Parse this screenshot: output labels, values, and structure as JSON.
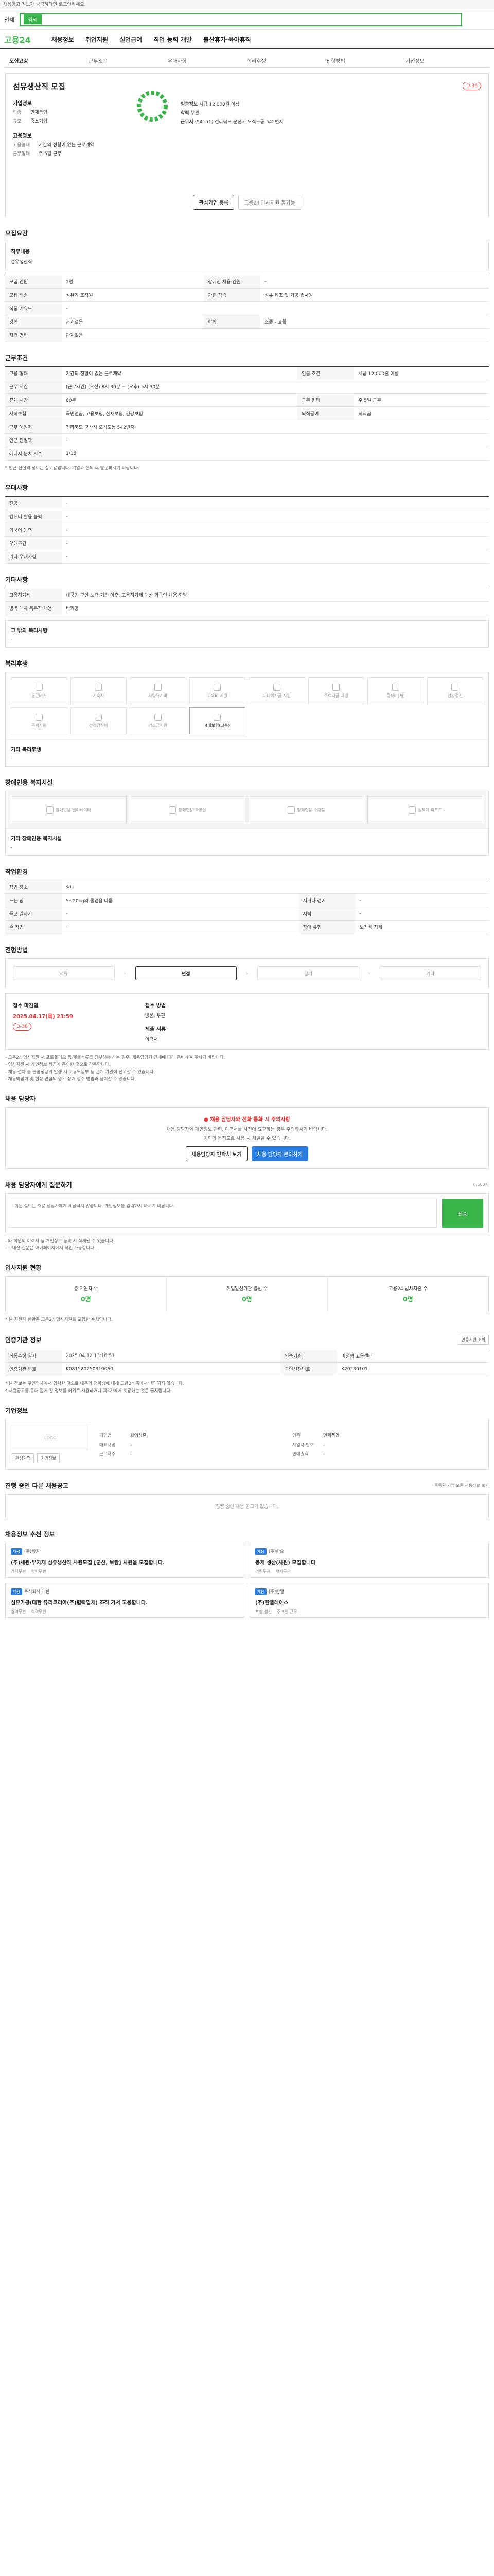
{
  "top_notice": "채용공고 정보가 궁금하다면 로그인하세요.",
  "search": {
    "select": "전체",
    "placeholder": "검색",
    "button": "검색"
  },
  "gnb": {
    "logo_a": "고용",
    "logo_b": "24",
    "items": [
      "채용정보",
      "취업지원",
      "실업급여",
      "직업 능력 개발",
      "출산휴가·육아휴직"
    ]
  },
  "tabs": [
    "모집요강",
    "근무조건",
    "우대사항",
    "복리후생",
    "전형방법",
    "기업정보"
  ],
  "header": {
    "title": "섬유생산직 모집",
    "dday": "D-36",
    "company_label": "기업정보",
    "company_rows": [
      {
        "k": "업종",
        "v": "면제품업"
      },
      {
        "k": "규모",
        "v": "중소기업"
      }
    ],
    "employment_label": "고용정보",
    "employment_rows": [
      {
        "k": "고용형태",
        "v": "기간의 정함이 없는 근로계약"
      },
      {
        "k": "근무형태",
        "v": "주 5일 근무"
      }
    ],
    "pay_label": "임금정보",
    "pay": "시급 12,000원 이상",
    "location_label": "근무지",
    "location": "(54151) 전라북도 군산시 오식도동 542번지",
    "career_label": "학력",
    "career": "무관",
    "apply_button": "관심기업 등록",
    "scrap_button": "고용24 입사지원 불가능"
  },
  "section_recruit": {
    "title": "모집요강",
    "duty_label": "직무내용",
    "duty_text": "섬유생산직",
    "rows": [
      {
        "k1": "모집 인원",
        "v1": "1명",
        "k2": "장애인 채용 인원",
        "v2": "-"
      },
      {
        "k1": "모집 직종",
        "v1": "섬유기 조작원",
        "k2": "관련 직종",
        "v2": "섬유 제조 및 가공 종사원"
      },
      {
        "k1": "직종 키워드",
        "v1": "-",
        "k2": "",
        "v2": ""
      },
      {
        "k1": "경력",
        "v1": "관계없음",
        "k2": "학력",
        "v2": "초졸 - 고졸"
      },
      {
        "k1": "자격 면허",
        "v1": "관계없음",
        "k2": "",
        "v2": ""
      }
    ]
  },
  "section_work": {
    "title": "근무조건",
    "rows": [
      {
        "k1": "고용 형태",
        "v1": "기간의 정함이 없는 근로계약",
        "k2": "임금 조건",
        "v2": "시급 12,000원 이상"
      },
      {
        "k1": "근무 시간",
        "v1": "(근무시간) (오전) 8시 30분 ~ (오후) 5시 30분",
        "k2": "",
        "v2": ""
      },
      {
        "k1": "휴게 시간",
        "v1": "60분",
        "k2": "근무 형태",
        "v2": "주 5일 근무"
      },
      {
        "k1": "사회보험",
        "v1": "국민연금, 고용보험, 산재보험, 건강보험",
        "k2": "퇴직급여",
        "v2": "퇴직금"
      },
      {
        "k1": "근무 예정지",
        "v1": "전라북도 군산시 오식도동 542번지",
        "k2": "",
        "v2": ""
      },
      {
        "k1": "인근 전철역",
        "v1": "-",
        "k2": "",
        "v2": ""
      },
      {
        "k1": "에너지 눈치 지수",
        "v1": "1/18",
        "k2": "",
        "v2": ""
      }
    ],
    "note": "* 인근 전철역 정보는 참고용입니다. 기업과 협의 후 방문하시기 바랍니다."
  },
  "section_pref": {
    "title": "우대사항",
    "rows": [
      {
        "k": "전공",
        "v": "-"
      },
      {
        "k": "컴퓨터 활용 능력",
        "v": "-"
      },
      {
        "k": "외국어 능력",
        "v": "-"
      },
      {
        "k": "우대조건",
        "v": "-"
      },
      {
        "k": "기타 우대사항",
        "v": "-"
      }
    ]
  },
  "section_etc": {
    "title": "기타사항",
    "rows": [
      {
        "k": "고용허가제",
        "v": "내국인 구인 노력 기간 이후, 고용허가제 대상 외국인 채용 희망"
      },
      {
        "k": "병역 대체 복무자 채용",
        "v": "비희망"
      }
    ],
    "etc_label": "그 밖의 복리사항",
    "etc_value": "-"
  },
  "section_welfare": {
    "title": "복리후생",
    "items": [
      {
        "label": "통근버스",
        "on": false
      },
      {
        "label": "기숙사",
        "on": false
      },
      {
        "label": "차량유지비",
        "on": false
      },
      {
        "label": "교육비 지원",
        "on": false
      },
      {
        "label": "자녀학자금 지원",
        "on": false
      },
      {
        "label": "주택자금 지원",
        "on": false
      },
      {
        "label": "중식비(제)",
        "on": false
      },
      {
        "label": "건강검진",
        "on": false
      },
      {
        "label": "주택지원",
        "on": false
      },
      {
        "label": "건강검진비",
        "on": false
      },
      {
        "label": "경조금지원",
        "on": false
      },
      {
        "label": "4대보험(고용)",
        "on": true
      }
    ],
    "other_label": "기타 복리후생",
    "other_value": "-"
  },
  "section_disabled": {
    "title": "장애인용 복지시설",
    "items": [
      "장애인용 엘리베이터",
      "장애인용 화장실",
      "장애인용 주차장",
      "휠체어 리프트"
    ],
    "other_label": "기타 장애인용 복지시설",
    "other_value": "-"
  },
  "section_work_env": {
    "title": "작업환경",
    "rows": [
      {
        "k1": "작업 장소",
        "v1": "실내",
        "k2": "",
        "v2": ""
      },
      {
        "k1": "드는 힘",
        "v1": "5~20kg의 물건을 다룸",
        "k2": "서거나 걷기",
        "v2": "-"
      },
      {
        "k1": "듣고 말하기",
        "v1": "-",
        "k2": "시력",
        "v2": "-"
      },
      {
        "k1": "손 작업",
        "v1": "-",
        "k2": "장애 유형",
        "v2": "보전성 지체"
      }
    ]
  },
  "section_process": {
    "title": "전형방법",
    "steps": [
      "서류",
      "면접",
      "필기",
      "기타"
    ],
    "active": 1,
    "deadline_label": "접수 마감일",
    "deadline": "2025.04.17(목) 23:59",
    "dday": "D-36",
    "method_label": "접수 방법",
    "method": "방문, 우편",
    "doc_label": "제출 서류",
    "doc": "이력서",
    "notes": [
      "- 고용24 입사지원 시 포트폴리오 등 제출서류를 첨부해야 하는 경우, 채용담당자 안내에 따라 준비하여 주시기 바랍니다.",
      "- 입사지원 시 개인정보 제공에 동의한 것으로 간주합니다.",
      "- 채용 절차 중 불공정행위 발생 시 고용노동부 등 관계 기관에 신고할 수 있습니다.",
      "- 채용박람회 및 현장 면접의 경우 상기 접수 방법과 상이할 수 있습니다."
    ]
  },
  "section_manager": {
    "title": "채용 담당자",
    "warning": "채용 담당자와 전화 통화 시 주의사항",
    "desc1": "채용 담당자와 개인정보 관련, 이력서를 사전에 요구하는 경우 주의하시기 바랍니다.",
    "desc2": "이외의 목적으로 사용 시 처벌될 수 있습니다.",
    "btn_phone": "채용담당자 연락처 보기",
    "btn_email": "채용 담당자 문의하기"
  },
  "section_qna": {
    "title": "채용 담당자에게 질문하기",
    "counter": "0/500자",
    "placeholder": "회원 정보는 채용 담당자에게 제공되지 않습니다. 개인정보를 입력하지 마시기 바랍니다.",
    "send": "전송",
    "notes": [
      "- 타 회원의 이력서 등 개인정보 등록 시 삭제될 수 있습니다.",
      "- 보내신 질문은 마이페이지에서 확인 가능합니다."
    ]
  },
  "section_stats": {
    "title": "입사지원 현황",
    "items": [
      {
        "label": "총 지원자 수",
        "value": "0명"
      },
      {
        "label": "취업알선기관 알선 수",
        "value": "0명"
      },
      {
        "label": "고용24 입사지원 수",
        "value": "0명"
      }
    ],
    "note": "* 본 지원자 현황은 고용24 입사지원을 포함한 수치입니다."
  },
  "section_info": {
    "title": "인증기관 정보",
    "btn": "인증기관 조회",
    "rows": [
      {
        "k1": "최종수정 일자",
        "v1": "2025.04.12 13:16:51",
        "k2": "인증기관",
        "v2": "비정형 고용센터"
      },
      {
        "k1": "인증기관 번호",
        "v1": "K081520250310060",
        "k2": "구인신청번호",
        "v2": "K20230101"
      }
    ],
    "notes": [
      "* 본 정보는 구인업체에서 입력한 것으로 내용의 정확성에 대해 고용24 측에서 책임지지 않습니다.",
      "* 채용공고를 통해 알게 된 정보를 허위로 사용하거나 제3자에게 제공하는 것은 금지됩니다."
    ]
  },
  "section_company": {
    "title": "기업정보",
    "logo_alt": "LOGO",
    "btn_interest": "관심기업",
    "btn_info": "기업정보",
    "info": [
      {
        "k": "기업명",
        "v": "화영섬유"
      },
      {
        "k": "업종",
        "v": "면제품업"
      },
      {
        "k": "대표자명",
        "v": "-"
      },
      {
        "k": "사업자 번호",
        "v": "-"
      },
      {
        "k": "근로자수",
        "v": "-"
      },
      {
        "k": "연매출액",
        "v": "-"
      }
    ]
  },
  "section_ongoing": {
    "title": "진행 중인 다른 채용공고",
    "link": "등록된 기업 모든 채용정보 보기",
    "empty": "진행 중인 채용 공고가 없습니다."
  },
  "section_recommend": {
    "title": "채용정보 추천 정보",
    "cards": [
      {
        "company": "(주)세원",
        "title": "(주)세원·부자재 섬유생산직 사원모집 [군산, 보람] 사원을 모집합니다.",
        "meta1": "경력무관",
        "meta2": "학력무관"
      },
      {
        "company": "(주)한솔",
        "title": "봉제 생산(사원) 모집합니다",
        "meta1": "경력무관",
        "meta2": "학력무관"
      },
      {
        "company": "주식회사 대한",
        "title": "섬유가공(대한 유리코리아(주)협력업체) 조직 가서 고용합니다.",
        "meta1": "경력무관",
        "meta2": "학력무관"
      },
      {
        "company": "(주)한별",
        "title": "(주)한별레이스",
        "meta1": "포장 생산",
        "meta2": "주 5일 근무"
      }
    ]
  }
}
